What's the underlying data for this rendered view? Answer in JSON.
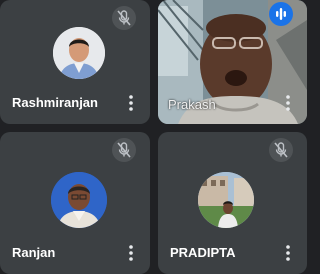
{
  "participants": [
    {
      "name": "Rashmiranjan",
      "muted": true,
      "view": "avatar"
    },
    {
      "name": "Prakash",
      "muted": false,
      "speaking": true,
      "view": "video"
    },
    {
      "name": "Ranjan",
      "muted": true,
      "view": "avatar"
    },
    {
      "name": "PRADIPTA",
      "muted": true,
      "view": "avatar"
    }
  ],
  "icons": {
    "mic_off": "mic-off-icon",
    "speaking": "audio-level-icon",
    "more": "more-vert-icon"
  },
  "colors": {
    "background": "#202124",
    "tile": "#3c4043",
    "speaking_accent": "#1a73e8",
    "name_text": "#ffffff"
  }
}
